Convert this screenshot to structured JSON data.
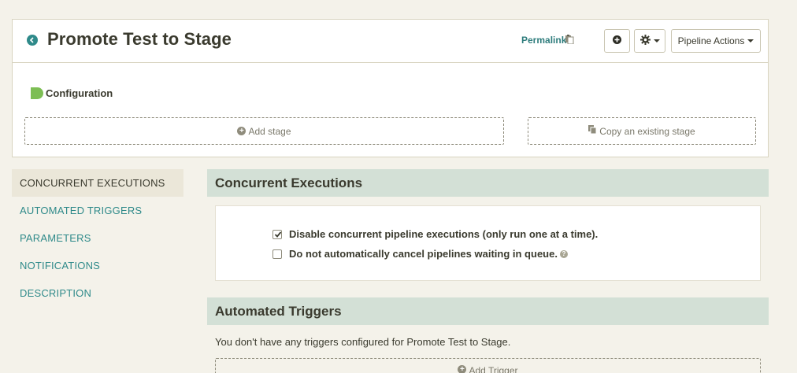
{
  "header": {
    "title": "Promote Test to Stage",
    "permalink": "Permalink",
    "pipeline_actions": "Pipeline Actions"
  },
  "stages": {
    "configuration_label": "Configuration",
    "add_stage": "Add stage",
    "copy_stage": "Copy an existing stage"
  },
  "sidebar": {
    "items": [
      {
        "label": "CONCURRENT EXECUTIONS",
        "active": true
      },
      {
        "label": "AUTOMATED TRIGGERS",
        "active": false
      },
      {
        "label": "PARAMETERS",
        "active": false
      },
      {
        "label": "NOTIFICATIONS",
        "active": false
      },
      {
        "label": "DESCRIPTION",
        "active": false
      }
    ]
  },
  "concurrent": {
    "heading": "Concurrent Executions",
    "option1": {
      "label": "Disable concurrent pipeline executions (only run one at a time).",
      "checked": true
    },
    "option2": {
      "label": "Do not automatically cancel pipelines waiting in queue.",
      "checked": false
    }
  },
  "triggers": {
    "heading": "Automated Triggers",
    "empty_message": "You don't have any triggers configured for Promote Test to Stage.",
    "add_trigger": "Add Trigger"
  },
  "colors": {
    "accent": "#2f8a8a",
    "section_header_bg": "#d3e0d6",
    "config_node": "#7dbe54",
    "page_bg": "#f4f2ea"
  },
  "icons": [
    "back-icon",
    "clipboard-icon",
    "add-icon",
    "gear-icon",
    "plus-circle-icon",
    "copy-icon",
    "checkbox-icon",
    "help-icon"
  ]
}
